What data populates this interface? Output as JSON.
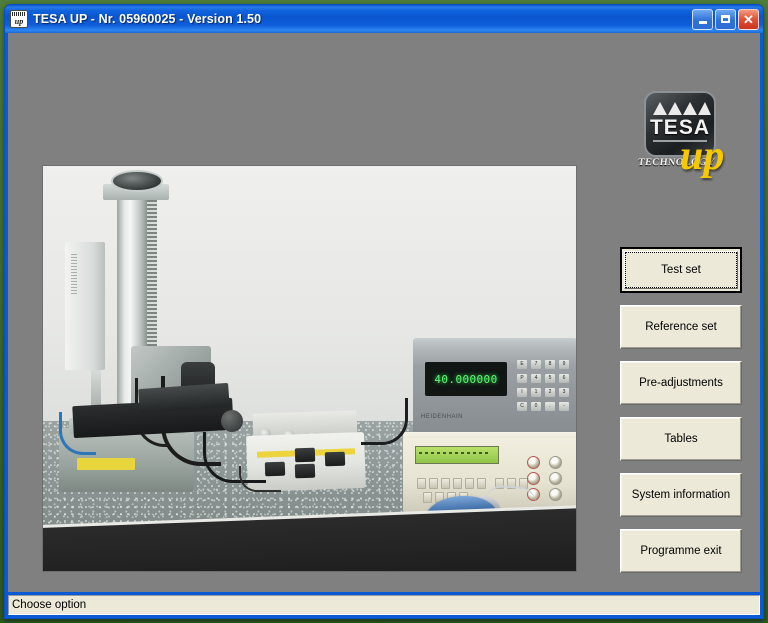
{
  "window": {
    "title": "TESA UP  -  Nr. 05960025  -  Version 1.50",
    "icon": "tesa-up-app-icon",
    "controls": {
      "minimize": "minimize-icon",
      "maximize": "maximize-icon",
      "close": "close-icon"
    }
  },
  "logo": {
    "brand": "TESA",
    "tagline": "TECHNOLOGY",
    "suffix": "up"
  },
  "menu": {
    "buttons": [
      {
        "label": "Test set",
        "default": true
      },
      {
        "label": "Reference set",
        "default": false
      },
      {
        "label": "Pre-adjustments",
        "default": false
      },
      {
        "label": "Tables",
        "default": false
      },
      {
        "label": "System information",
        "default": false
      },
      {
        "label": "Programme exit",
        "default": false
      }
    ]
  },
  "photo": {
    "alt": "TESA UP measuring bench: height gauge column with probe on granite base, control box, digital counter and benchtop instrument",
    "counter_display": "40.000000",
    "keypad": [
      "7",
      "8",
      "9",
      "4",
      "5",
      "6",
      "1",
      "2",
      "3",
      "0",
      ".",
      "-"
    ],
    "keypad_fn": [
      "ENT",
      "PGM",
      "INP",
      "CL"
    ]
  },
  "statusbar": {
    "text": "Choose option"
  },
  "colors": {
    "desktop": "#3f7033",
    "titlebar": "#0a59d4",
    "client": "#808080",
    "button_face": "#ece9d8",
    "logo_yellow": "#f6c800",
    "display_green": "#5dfb70",
    "close_red": "#c8351c"
  }
}
